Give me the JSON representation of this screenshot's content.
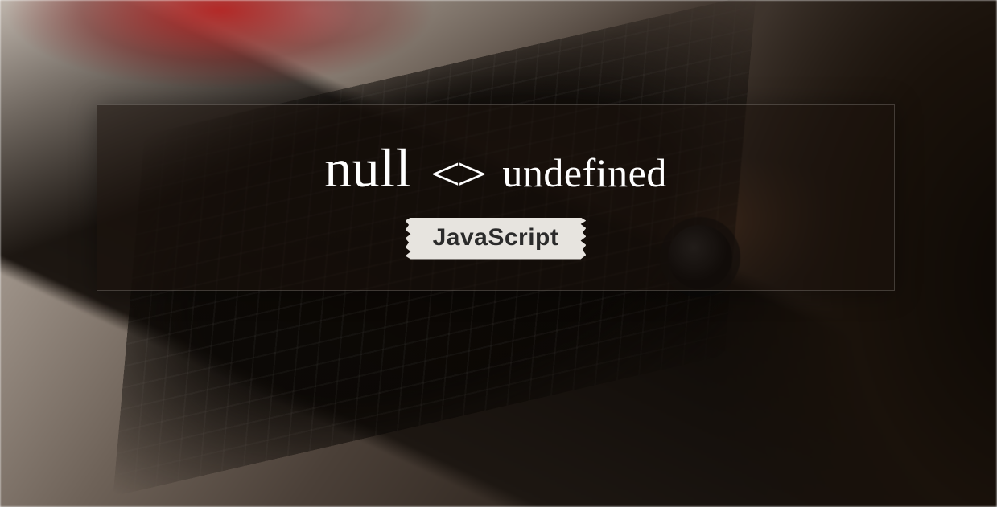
{
  "banner": {
    "left_word": "null",
    "operator": "<>",
    "right_word": "undefined",
    "tag_label": "JavaScript"
  }
}
